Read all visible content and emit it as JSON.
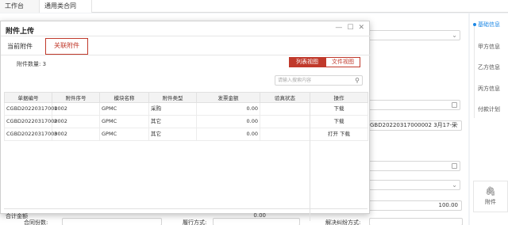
{
  "tabs": [
    {
      "label": "工作台",
      "close": "⊗"
    },
    {
      "label": "通用类合同",
      "close": "×"
    }
  ],
  "modal": {
    "title": "附件上传",
    "subtabs": [
      "当前附件",
      "关联附件"
    ],
    "file_count_label": "附件数量: 3",
    "view_buttons": [
      "列表视图",
      "文件视图"
    ],
    "search_placeholder": "请输入搜索内容",
    "columns": [
      "单据编号",
      "附件序号",
      "模块名称",
      "附件类型",
      "发票金额",
      "验真状态",
      "操作"
    ],
    "rows": [
      {
        "doc_no": "CGBD20220317000002",
        "seq": "1",
        "module": "GPMC",
        "type": "采购",
        "amount": "0.00",
        "status": "",
        "action": "下载"
      },
      {
        "doc_no": "CGBD20220317000002",
        "seq": "2",
        "module": "GPMC",
        "type": "其它",
        "amount": "0.00",
        "status": "",
        "action": "下载"
      },
      {
        "doc_no": "CGBD20220317000002",
        "seq": "3",
        "module": "GPMC",
        "type": "其它",
        "amount": "0.00",
        "status": "",
        "action": "打开 下载"
      }
    ],
    "total_label": "合计金额",
    "total_value": "0.00"
  },
  "background": {
    "contract_field": "GBD20220317000002 3月17-采",
    "amount_value": "100.00",
    "bottom_labels": [
      "合同份数:",
      "履行方式:",
      "解决纠纷方式:"
    ]
  },
  "right_nav": {
    "items": [
      "基础信息",
      "甲方信息",
      "乙方信息",
      "丙方信息",
      "付款计划"
    ],
    "attach_label": "附件"
  },
  "colors": {
    "accent": "#c0392b",
    "nav_active": "#1e88e5"
  }
}
